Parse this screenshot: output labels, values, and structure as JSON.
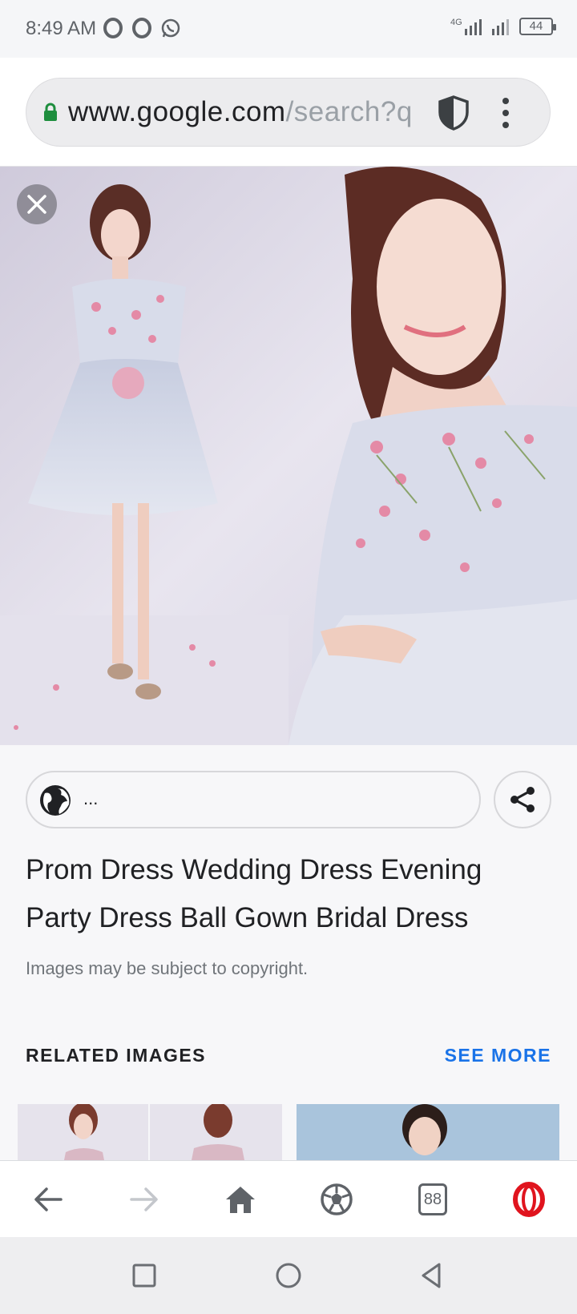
{
  "status_bar": {
    "time": "8:49 AM",
    "notification_icons": [
      "opera-icon",
      "opera-icon",
      "whatsapp-icon"
    ],
    "network": "4G",
    "battery": "44"
  },
  "address_bar": {
    "domain": "www.google.com",
    "path": "/search?q",
    "secure": true
  },
  "image_viewer": {
    "source_text": "...",
    "title": "Prom Dress Wedding Dress Evening Party Dress Ball Gown Bridal Dress",
    "copyright_notice": "Images may be subject to copyright."
  },
  "related": {
    "label": "RELATED IMAGES",
    "see_more": "SEE MORE"
  },
  "toolbar": {
    "tab_count": "88"
  },
  "colors": {
    "accent_blue": "#1a73e8",
    "opera_red": "#e0141e",
    "lock_green": "#1e8e3e"
  }
}
